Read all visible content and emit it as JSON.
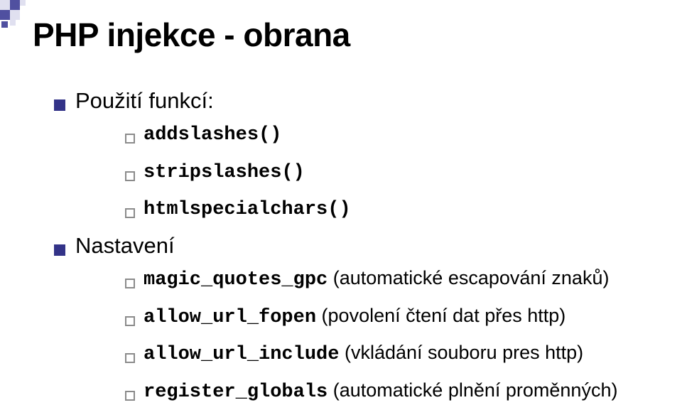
{
  "title": "PHP injekce - obrana",
  "sections": [
    {
      "label": "Použití funkcí:",
      "items": [
        {
          "code": "addslashes()",
          "note": ""
        },
        {
          "code": "stripslashes()",
          "note": ""
        },
        {
          "code": "htmlspecialchars()",
          "note": ""
        }
      ]
    },
    {
      "label": "Nastavení",
      "items": [
        {
          "code": "magic_quotes_gpc",
          "note": " (automatické escapování znaků)"
        },
        {
          "code": "allow_url_fopen",
          "note": " (povolení čtení dat přes http)"
        },
        {
          "code": "allow_url_include",
          "note": " (vkládání souboru pres http)"
        },
        {
          "code": "register_globals",
          "note": " (automatické plnění proměnných)"
        }
      ]
    }
  ]
}
